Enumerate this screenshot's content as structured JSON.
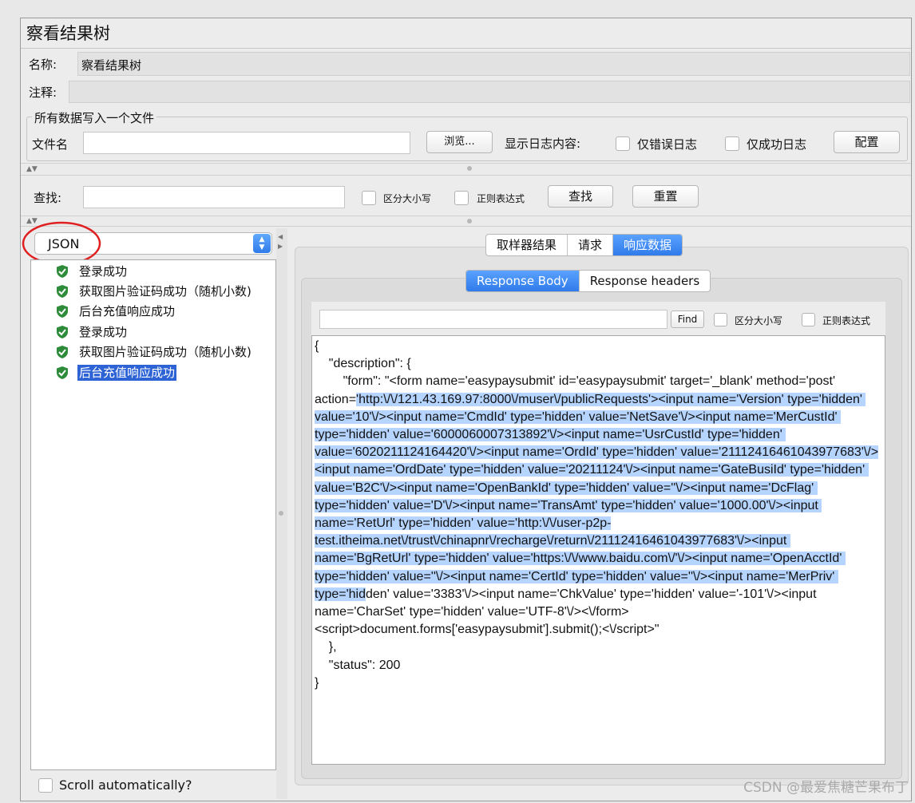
{
  "window": {
    "title": "察看结果树"
  },
  "name_field": {
    "label": "名称:",
    "value": "察看结果树"
  },
  "comment_field": {
    "label": "注释:",
    "value": ""
  },
  "file_group": {
    "legend": "所有数据写入一个文件",
    "file_label": "文件名",
    "file_value": "",
    "browse_label": "浏览...",
    "log_label": "显示日志内容:",
    "errors_only_label": "仅错误日志",
    "success_only_label": "仅成功日志",
    "config_label": "配置"
  },
  "search_bar": {
    "label": "查找:",
    "value": "",
    "case_label": "区分大小写",
    "regex_label": "正则表达式",
    "find_label": "查找",
    "reset_label": "重置"
  },
  "renderer": {
    "selected": "JSON"
  },
  "tree": {
    "items": [
      {
        "label": "登录成功"
      },
      {
        "label": "获取图片验证码成功（随机小数)"
      },
      {
        "label": "后台充值响应成功"
      },
      {
        "label": "登录成功"
      },
      {
        "label": "获取图片验证码成功（随机小数)"
      },
      {
        "label": "后台充值响应成功"
      }
    ]
  },
  "result_tabs": {
    "tab1": "取样器结果",
    "tab2": "请求",
    "tab3": "响应数据"
  },
  "response_tabs": {
    "tab1": "Response Body",
    "tab2": "Response headers"
  },
  "inner_search": {
    "value": "",
    "find_label": "Find",
    "case_label": "区分大小写",
    "regex_label": "正则表达式"
  },
  "response_body": {
    "p1": "{\n    \"description\": {\n        \"form\": \"<form name='easypaysubmit' id='easypaysubmit' target='_blank' method='post' action=",
    "p2": "'http:\\/\\/121.43.169.97:8000\\/muser\\/publicRequests'><input name='Version' type='hidden' value='10'\\/><input name='CmdId' type='hidden' value='NetSave'\\/><input name='MerCustId' type='hidden' value='6000060007313892'\\/><input name='UsrCustId' type='hidden' value='6020211124164420'\\/><input name='OrdId' type='hidden' value='21112416461043977683'\\/><input name='OrdDate' type='hidden' value='20211124'\\/><input name='GateBusiId' type='hidden' value='B2C'\\/><input name='OpenBankId' type='hidden' value=''\\/><input name='DcFlag' type='hidden' value='D'\\/><input name='TransAmt' type='hidden' value='1000.00'\\/><input name='RetUrl' type='hidden' value='http:\\/\\/user-p2p-test.itheima.net\\/trust\\/chinapnr\\/recharge\\/return\\/21112416461043977683'\\/><input name='BgRetUrl' type='hidden' value='https:\\/\\/www.baidu.com\\/'\\/><input name='OpenAcctId' type='hidden' value=''\\/><input name='CertId' type='hidden' value=''\\/><input name='MerPriv' type='hid",
    "p3": "den' value='3383'\\/><input name='ChkValue' type='hidden' value='-101'\\/><input name='CharSet' type='hidden' value='UTF-8'\\/><\\/form><script>document.forms['easypaysubmit'].submit();<\\/script>\"\n    },\n    \"status\": 200\n}"
  },
  "scroll_auto": {
    "label": "Scroll automatically?"
  },
  "watermark": "CSDN @最爱焦糖芒果布丁",
  "colors": {
    "selection": "#2e63d6",
    "tab_active": "#2f7bea",
    "text_highlight": "#b5d4ff",
    "annotation": "#e02020"
  }
}
